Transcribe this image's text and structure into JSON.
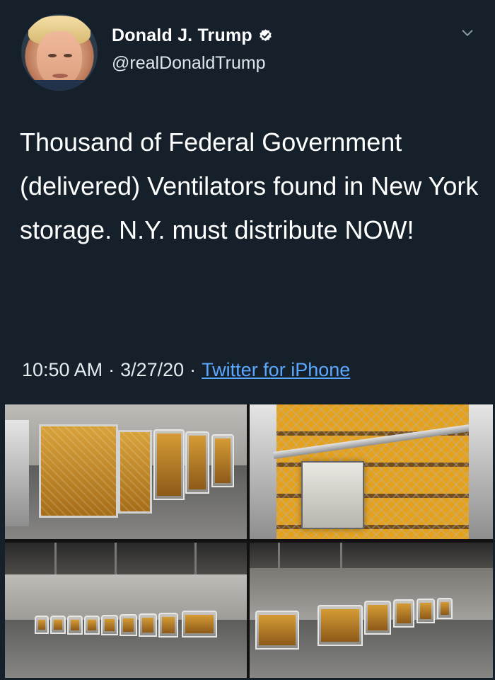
{
  "profile": {
    "display_name": "Donald J. Trump",
    "handle": "@realDonaldTrump",
    "verified_icon": "verified-badge-icon",
    "menu_icon": "chevron-down-icon"
  },
  "tweet": {
    "text": "Thousand of Federal Government (delivered) Ventilators found in New York storage. N.Y. must distribute NOW!",
    "time": "10:50 AM",
    "date": "3/27/20",
    "separator": "·",
    "source": "Twitter for iPhone"
  },
  "photos": {
    "count": 4
  },
  "colors": {
    "background": "#15202b",
    "text": "#ffffff",
    "link": "#5ba8ff"
  }
}
